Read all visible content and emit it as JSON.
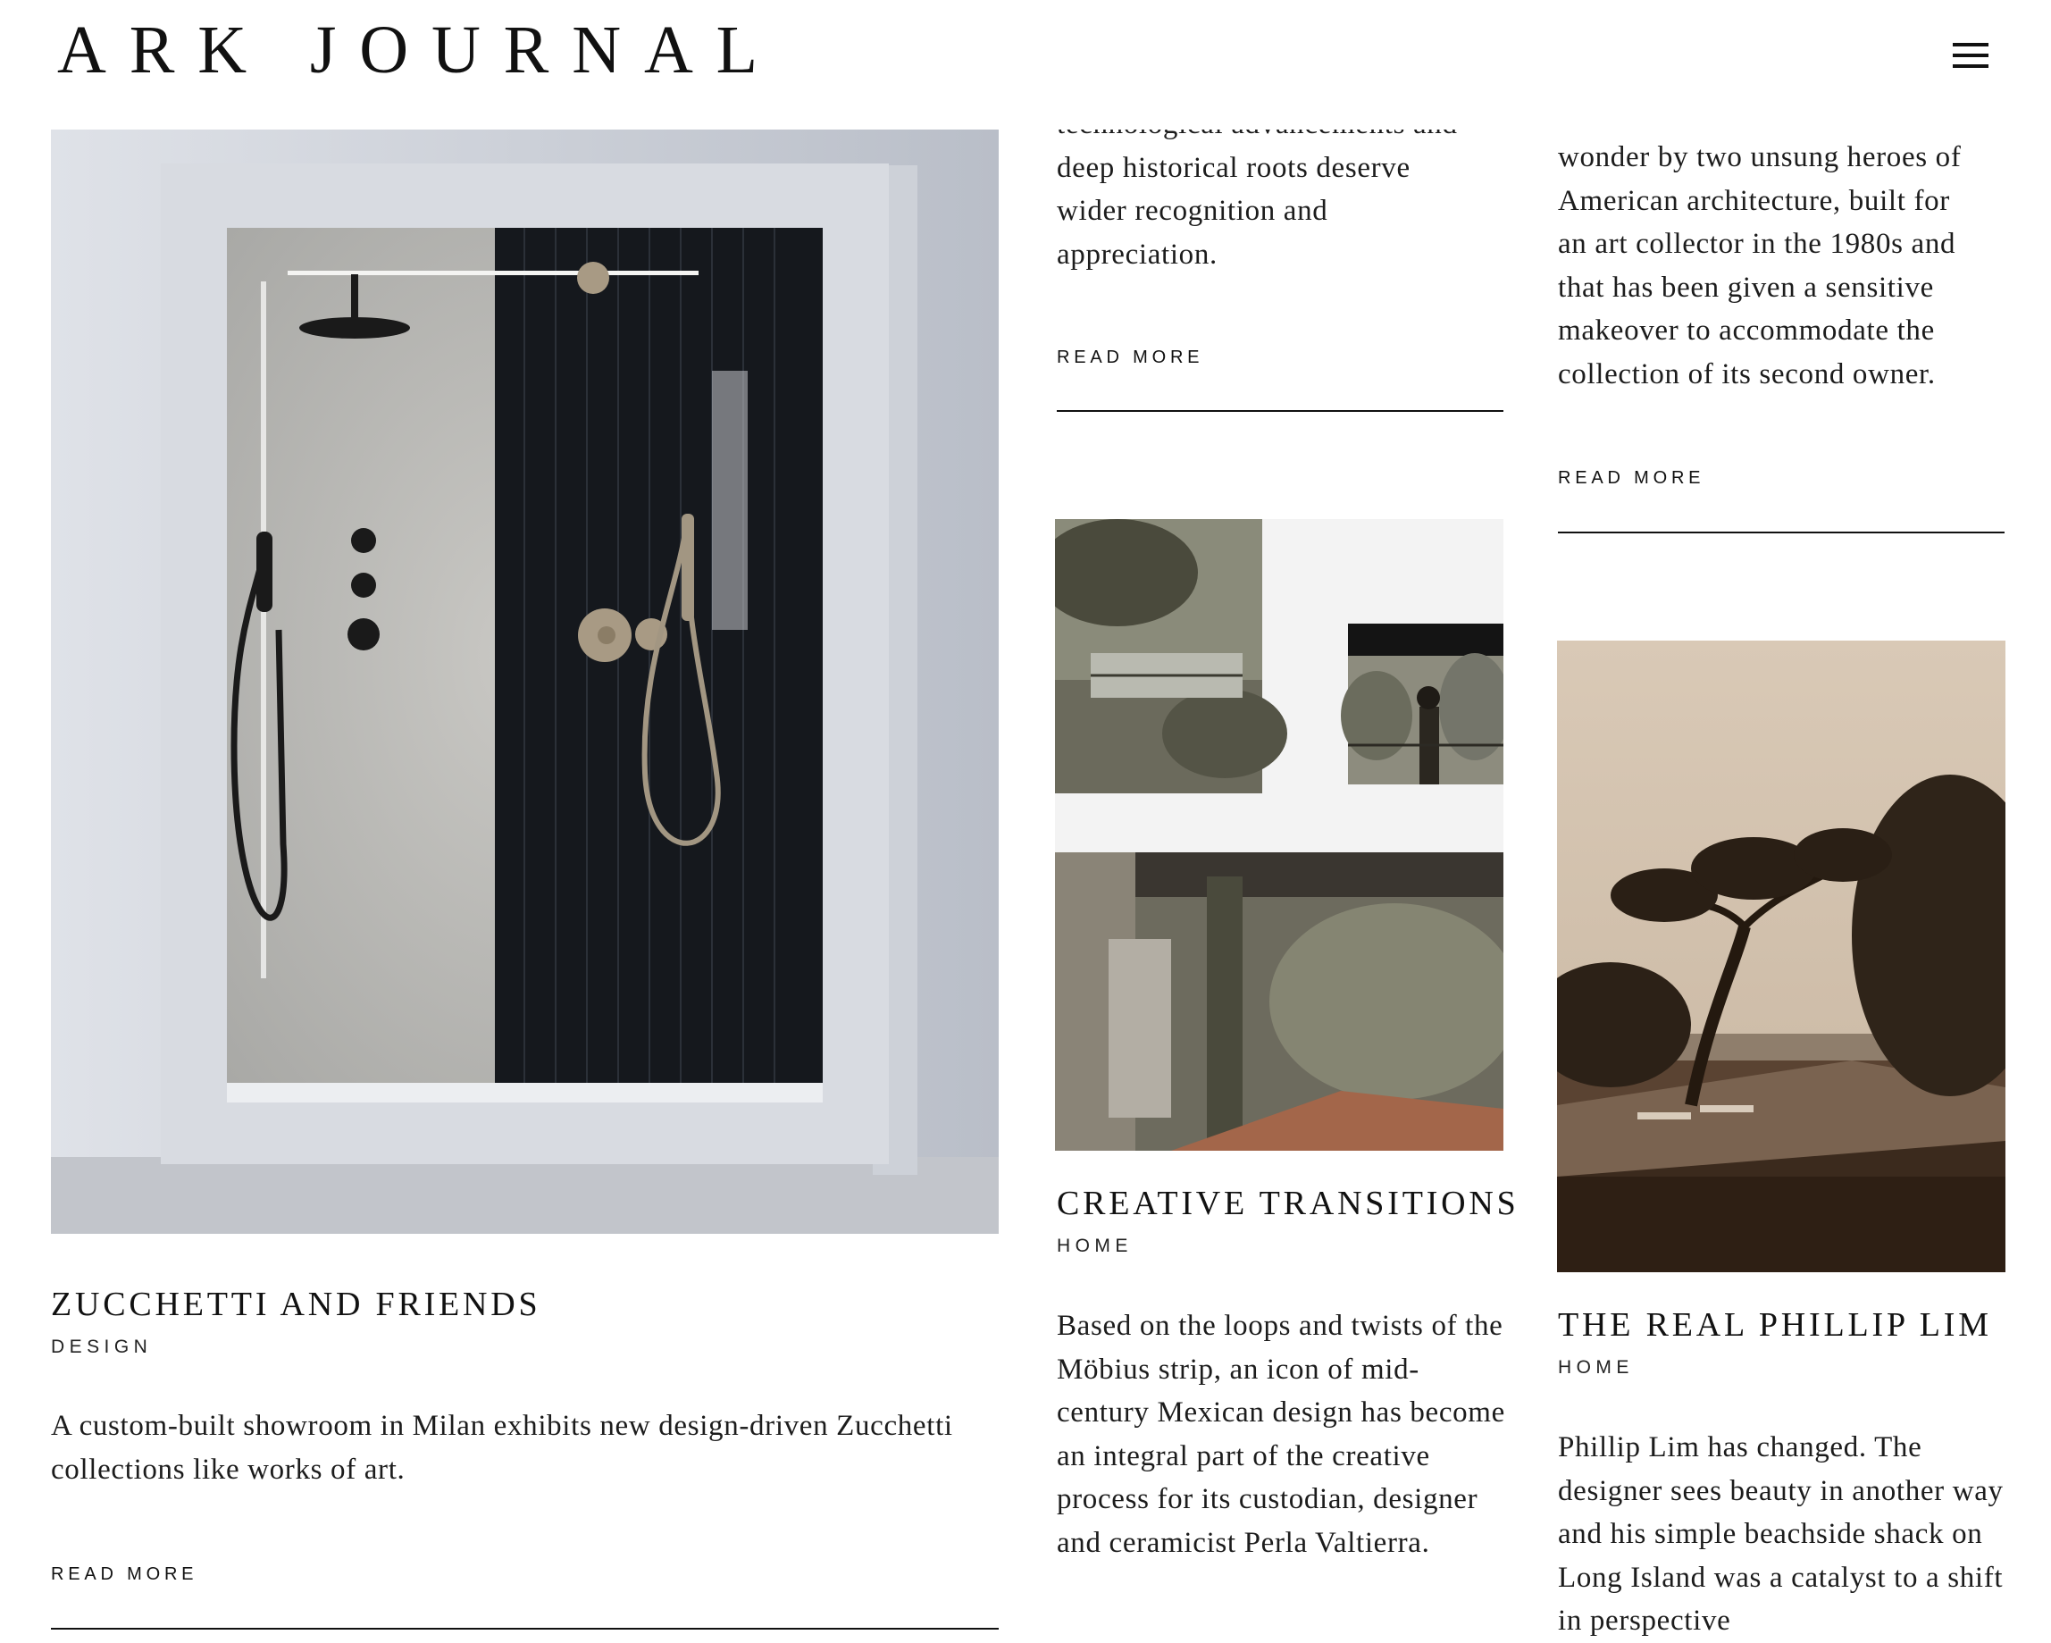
{
  "header": {
    "logo": "ARK JOURNAL",
    "menu_icon": "hamburger-menu-icon"
  },
  "articles": [
    {
      "title": "ZUCCHETTI AND FRIENDS",
      "category": "DESIGN",
      "excerpt": "A custom-built showroom in Milan exhibits new design-driven Zucchetti collections like works of art.",
      "read_more": "READ MORE",
      "image": "shower-showroom-photo"
    },
    {
      "excerpt_tail": [
        "technological advancements and",
        "deep historical roots deserve",
        "wider recognition and",
        "appreciation."
      ],
      "read_more": "READ MORE"
    },
    {
      "excerpt_tail": [
        "wonder by two unsung heroes of",
        "American architecture, built for",
        "an art collector in the 1980s and",
        "that has been given a sensitive",
        "makeover to accommodate the",
        "collection of its second owner."
      ],
      "read_more": "READ MORE"
    },
    {
      "title": "CREATIVE TRANSITIONS",
      "category": "HOME",
      "excerpt": "Based on the loops and twists of the Möbius strip, an icon of mid-century Mexican design has become an integral part of the creative process for its custodian, designer and ceramicist Perla Valtierra.",
      "image": "mexican-house-collage-photo"
    },
    {
      "title": "THE REAL PHILLIP LIM",
      "category": "HOME",
      "excerpt": "Phillip Lim has changed. The designer sees beauty in another way and his simple beachside shack on Long Island was a catalyst to a shift in perspective",
      "image": "beachside-tree-photo"
    }
  ]
}
